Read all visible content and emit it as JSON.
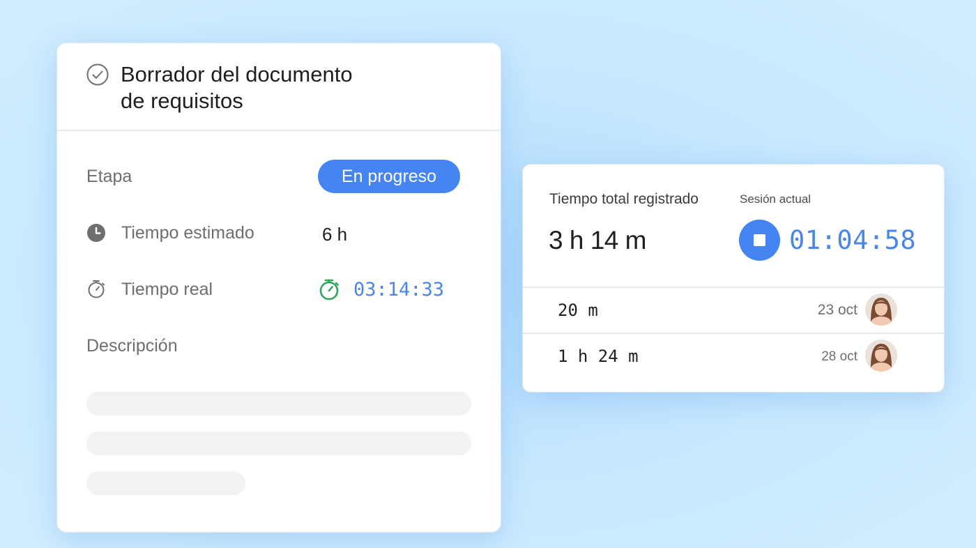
{
  "task": {
    "title_line1": "Borrador del documento",
    "title_line2": "de requisitos",
    "stage_label": "Etapa",
    "stage_value": "En progreso",
    "estimated_label": "Tiempo estimado",
    "estimated_value": "6 h",
    "actual_label": "Tiempo real",
    "actual_value": "03:14:33",
    "description_label": "Descripción"
  },
  "tracking": {
    "total_label": "Tiempo total registrado",
    "total_value": "3 h 14 m",
    "session_label": "Sesión actual",
    "session_timer": "01:04:58",
    "entries": [
      {
        "duration": "20 m",
        "date": "23 oct"
      },
      {
        "duration": "1 h 24 m",
        "date": "28 oct"
      }
    ]
  },
  "colors": {
    "accent": "#4585f3",
    "timer_blue": "#4a86e8",
    "stopwatch_green": "#2da85a",
    "background": "#c7e8fe"
  },
  "icons": {
    "complete": "check-circle-icon",
    "estimated": "clock-icon",
    "actual": "stopwatch-icon",
    "running": "stopwatch-icon",
    "stop": "stop-icon"
  }
}
